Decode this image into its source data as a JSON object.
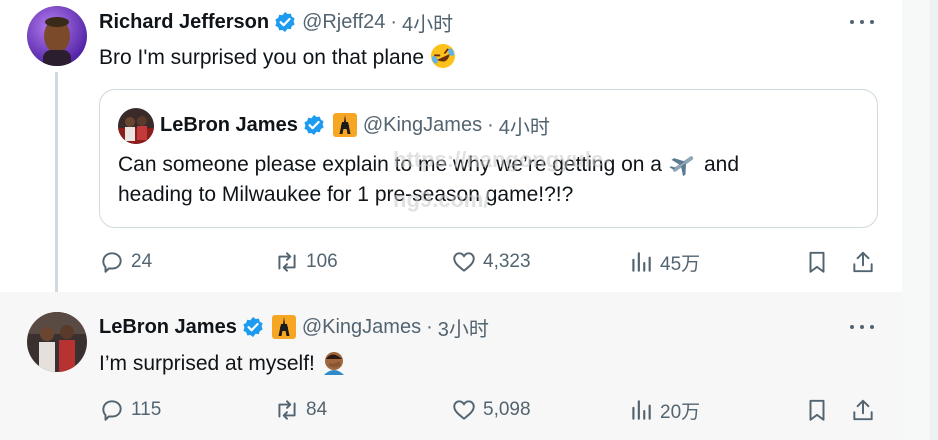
{
  "tweets": [
    {
      "author_name": "Richard Jefferson",
      "handle": "@Rjeff24",
      "time": "4小时",
      "text": "Bro I'm surprised you on that plane",
      "text_emoji": "rolling-on-floor-laughing",
      "quote": {
        "author_name": "LeBron James",
        "handle": "@KingJames",
        "time": "4小时",
        "text_line1_a": "Can someone please explain to me why we’re getting on a",
        "text_line1_emoji": "airplane",
        "text_line1_b": "and",
        "text_line2": "heading to Milwaukee for 1 pre-season game!?!?"
      },
      "stats": {
        "replies": "24",
        "reposts": "106",
        "likes": "4,323",
        "views": "45万"
      }
    },
    {
      "author_name": "LeBron James",
      "handle": "@KingJames",
      "time": "3小时",
      "text": "I’m surprised at myself!",
      "text_emoji": "person-facepalming",
      "stats": {
        "replies": "115",
        "reposts": "84",
        "likes": "5,098",
        "views": "20万"
      }
    }
  ],
  "watermark": "https://nangongyule-ng9.com/",
  "colors": {
    "verified": "#1d9bf0",
    "secondary_text": "#536471",
    "divider": "#cfd9de",
    "second_tweet_bg": "#f7f7f7"
  },
  "icons": [
    "reply-icon",
    "repost-icon",
    "like-icon",
    "views-icon",
    "bookmark-icon",
    "share-icon",
    "verified-badge-icon",
    "eiffel-tower-icon",
    "more-options-icon"
  ]
}
